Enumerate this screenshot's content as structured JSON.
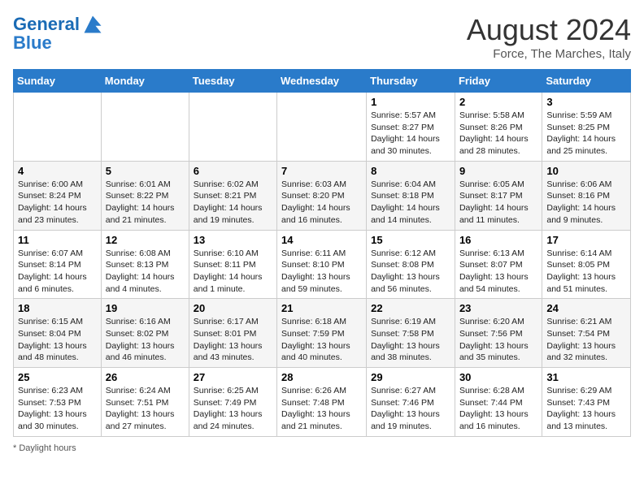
{
  "header": {
    "logo_line1": "General",
    "logo_line2": "Blue",
    "month_year": "August 2024",
    "location": "Force, The Marches, Italy"
  },
  "weekdays": [
    "Sunday",
    "Monday",
    "Tuesday",
    "Wednesday",
    "Thursday",
    "Friday",
    "Saturday"
  ],
  "weeks": [
    [
      {
        "day": "",
        "info": ""
      },
      {
        "day": "",
        "info": ""
      },
      {
        "day": "",
        "info": ""
      },
      {
        "day": "",
        "info": ""
      },
      {
        "day": "1",
        "info": "Sunrise: 5:57 AM\nSunset: 8:27 PM\nDaylight: 14 hours and 30 minutes."
      },
      {
        "day": "2",
        "info": "Sunrise: 5:58 AM\nSunset: 8:26 PM\nDaylight: 14 hours and 28 minutes."
      },
      {
        "day": "3",
        "info": "Sunrise: 5:59 AM\nSunset: 8:25 PM\nDaylight: 14 hours and 25 minutes."
      }
    ],
    [
      {
        "day": "4",
        "info": "Sunrise: 6:00 AM\nSunset: 8:24 PM\nDaylight: 14 hours and 23 minutes."
      },
      {
        "day": "5",
        "info": "Sunrise: 6:01 AM\nSunset: 8:22 PM\nDaylight: 14 hours and 21 minutes."
      },
      {
        "day": "6",
        "info": "Sunrise: 6:02 AM\nSunset: 8:21 PM\nDaylight: 14 hours and 19 minutes."
      },
      {
        "day": "7",
        "info": "Sunrise: 6:03 AM\nSunset: 8:20 PM\nDaylight: 14 hours and 16 minutes."
      },
      {
        "day": "8",
        "info": "Sunrise: 6:04 AM\nSunset: 8:18 PM\nDaylight: 14 hours and 14 minutes."
      },
      {
        "day": "9",
        "info": "Sunrise: 6:05 AM\nSunset: 8:17 PM\nDaylight: 14 hours and 11 minutes."
      },
      {
        "day": "10",
        "info": "Sunrise: 6:06 AM\nSunset: 8:16 PM\nDaylight: 14 hours and 9 minutes."
      }
    ],
    [
      {
        "day": "11",
        "info": "Sunrise: 6:07 AM\nSunset: 8:14 PM\nDaylight: 14 hours and 6 minutes."
      },
      {
        "day": "12",
        "info": "Sunrise: 6:08 AM\nSunset: 8:13 PM\nDaylight: 14 hours and 4 minutes."
      },
      {
        "day": "13",
        "info": "Sunrise: 6:10 AM\nSunset: 8:11 PM\nDaylight: 14 hours and 1 minute."
      },
      {
        "day": "14",
        "info": "Sunrise: 6:11 AM\nSunset: 8:10 PM\nDaylight: 13 hours and 59 minutes."
      },
      {
        "day": "15",
        "info": "Sunrise: 6:12 AM\nSunset: 8:08 PM\nDaylight: 13 hours and 56 minutes."
      },
      {
        "day": "16",
        "info": "Sunrise: 6:13 AM\nSunset: 8:07 PM\nDaylight: 13 hours and 54 minutes."
      },
      {
        "day": "17",
        "info": "Sunrise: 6:14 AM\nSunset: 8:05 PM\nDaylight: 13 hours and 51 minutes."
      }
    ],
    [
      {
        "day": "18",
        "info": "Sunrise: 6:15 AM\nSunset: 8:04 PM\nDaylight: 13 hours and 48 minutes."
      },
      {
        "day": "19",
        "info": "Sunrise: 6:16 AM\nSunset: 8:02 PM\nDaylight: 13 hours and 46 minutes."
      },
      {
        "day": "20",
        "info": "Sunrise: 6:17 AM\nSunset: 8:01 PM\nDaylight: 13 hours and 43 minutes."
      },
      {
        "day": "21",
        "info": "Sunrise: 6:18 AM\nSunset: 7:59 PM\nDaylight: 13 hours and 40 minutes."
      },
      {
        "day": "22",
        "info": "Sunrise: 6:19 AM\nSunset: 7:58 PM\nDaylight: 13 hours and 38 minutes."
      },
      {
        "day": "23",
        "info": "Sunrise: 6:20 AM\nSunset: 7:56 PM\nDaylight: 13 hours and 35 minutes."
      },
      {
        "day": "24",
        "info": "Sunrise: 6:21 AM\nSunset: 7:54 PM\nDaylight: 13 hours and 32 minutes."
      }
    ],
    [
      {
        "day": "25",
        "info": "Sunrise: 6:23 AM\nSunset: 7:53 PM\nDaylight: 13 hours and 30 minutes."
      },
      {
        "day": "26",
        "info": "Sunrise: 6:24 AM\nSunset: 7:51 PM\nDaylight: 13 hours and 27 minutes."
      },
      {
        "day": "27",
        "info": "Sunrise: 6:25 AM\nSunset: 7:49 PM\nDaylight: 13 hours and 24 minutes."
      },
      {
        "day": "28",
        "info": "Sunrise: 6:26 AM\nSunset: 7:48 PM\nDaylight: 13 hours and 21 minutes."
      },
      {
        "day": "29",
        "info": "Sunrise: 6:27 AM\nSunset: 7:46 PM\nDaylight: 13 hours and 19 minutes."
      },
      {
        "day": "30",
        "info": "Sunrise: 6:28 AM\nSunset: 7:44 PM\nDaylight: 13 hours and 16 minutes."
      },
      {
        "day": "31",
        "info": "Sunrise: 6:29 AM\nSunset: 7:43 PM\nDaylight: 13 hours and 13 minutes."
      }
    ]
  ],
  "footer": {
    "note": "Daylight hours"
  }
}
